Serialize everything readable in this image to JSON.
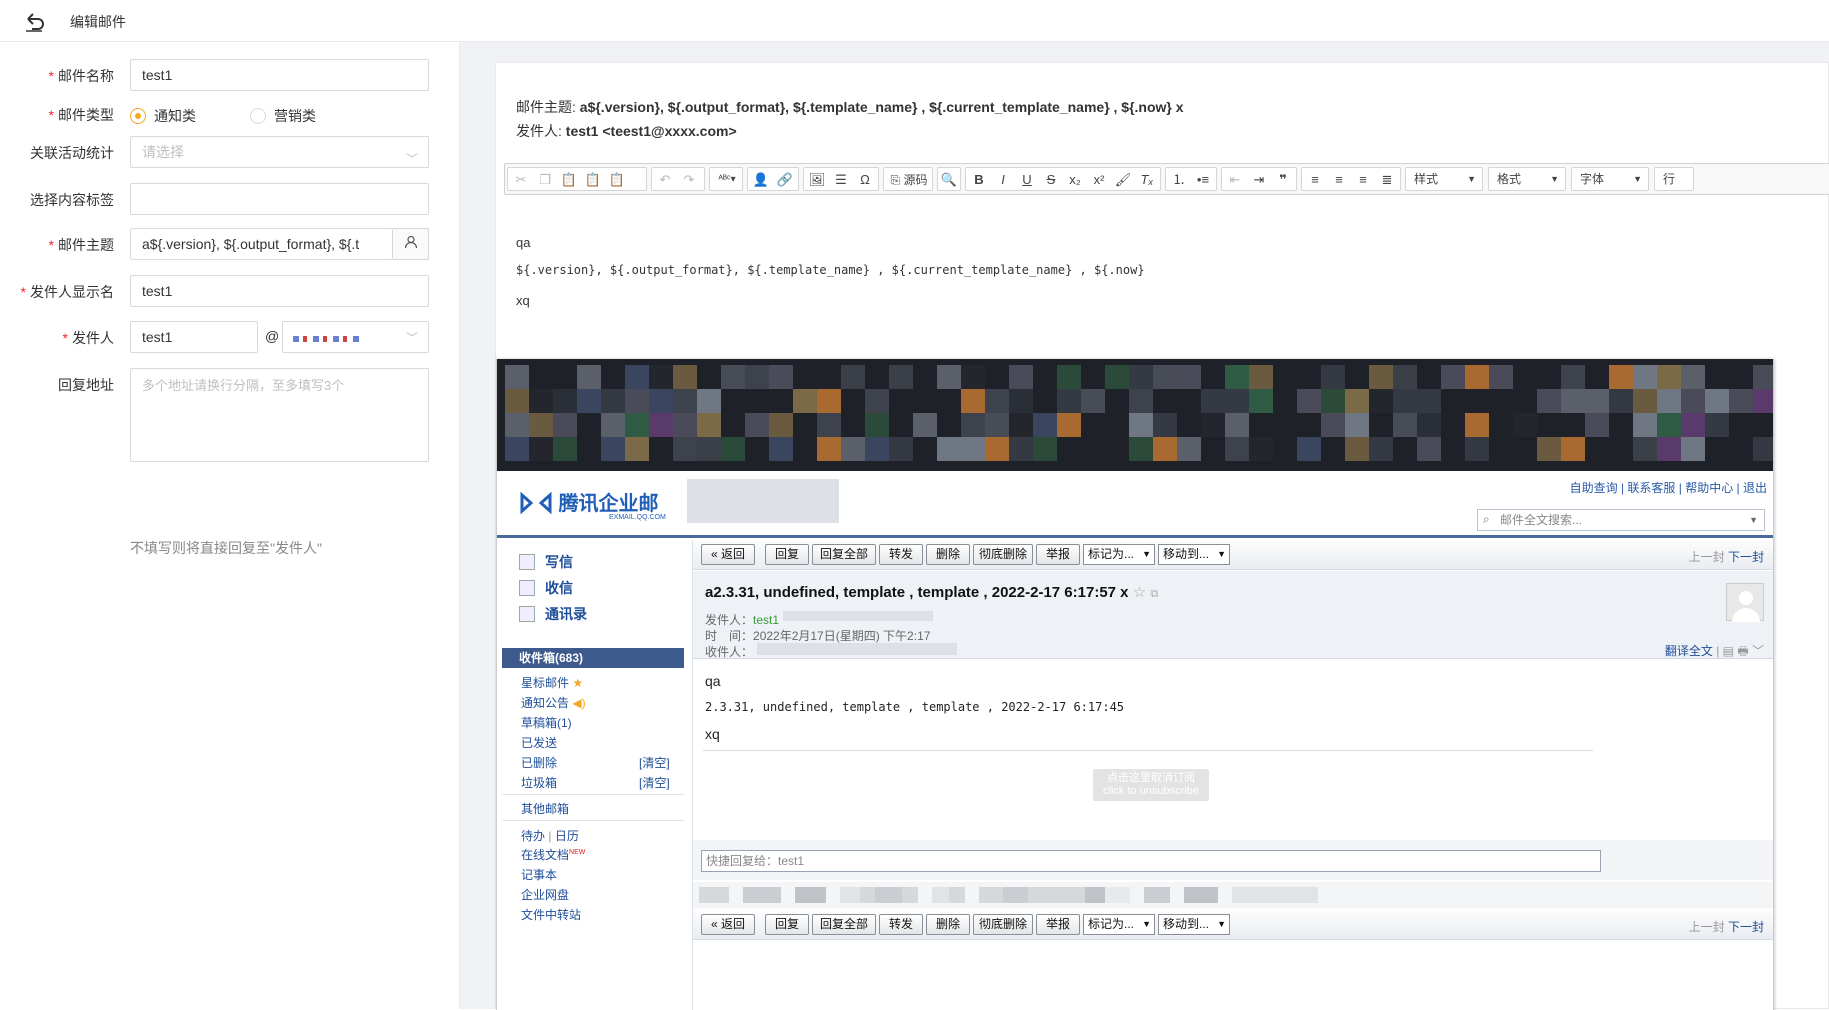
{
  "header": {
    "title": "编辑邮件"
  },
  "form": {
    "mail_name": {
      "label": "邮件名称",
      "value": "test1"
    },
    "mail_type": {
      "label": "邮件类型",
      "option1": "通知类",
      "option2": "营销类"
    },
    "activity": {
      "label": "关联活动统计",
      "placeholder": "请选择"
    },
    "tag": {
      "label": "选择内容标签",
      "value": ""
    },
    "subject": {
      "label": "邮件主题",
      "value": "a${.version}, ${.output_format}, ${.t"
    },
    "sender_name": {
      "label": "发件人显示名",
      "value": "test1"
    },
    "sender": {
      "label": "发件人",
      "value": "test1",
      "at": "@"
    },
    "reply": {
      "label": "回复地址",
      "placeholder": "多个地址请换行分隔，至多填写3个",
      "hint": "不填写则将直接回复至\"发件人\""
    }
  },
  "preview": {
    "subject_label": "邮件主题:",
    "subject_value": "a${.version}, ${.output_format}, ${.template_name} , ${.current_template_name} , ${.now} x",
    "from_label": "发件人:",
    "from_value": "test1 <teest1@xxxx.com>",
    "toolbar": {
      "source": "源码",
      "style": "样式",
      "format": "格式",
      "font": "字体",
      "more": "行"
    },
    "body_line1": "qa",
    "body_line2": "${.version},  ${.output_format},  ${.template_name} , ${.current_template_name} , ${.now}",
    "body_line3": "xq"
  },
  "qqmail": {
    "logo": "腾讯企业邮",
    "logo_sub": "EXMAIL.QQ.COM",
    "links": "自助查询 | 联系客服 | 帮助中心 | 退出",
    "search_placeholder": "邮件全文搜索...",
    "side": {
      "write": "写信",
      "receive": "收信",
      "contacts": "通讯录",
      "inbox": "收件箱(683)",
      "starred": "星标邮件",
      "notice": "通知公告",
      "drafts": "草稿箱(1)",
      "sent": "已发送",
      "deleted": "已删除",
      "spam": "垃圾箱",
      "clear": "[清空]",
      "other": "其他邮箱",
      "todo": "待办",
      "calendar": "日历",
      "docs": "在线文档",
      "new_badge": "NEW",
      "notes": "记事本",
      "disk": "企业网盘",
      "transfer": "文件中转站"
    },
    "bar": {
      "back": "« 返回",
      "reply": "回复",
      "reply_all": "回复全部",
      "forward": "转发",
      "delete": "删除",
      "delete_forever": "彻底删除",
      "report": "举报",
      "mark_as": "标记为...",
      "move_to": "移动到...",
      "prev": "上一封",
      "next": "下一封"
    },
    "mail": {
      "subject": "a2.3.31, undefined, template , template , 2022-2-17 6:17:57 x",
      "from_label": "发件人：",
      "from_value": "test1",
      "time_label": "时　间：",
      "time_value": "2022年2月17日(星期四) 下午2:17",
      "to_label": "收件人：",
      "translate": "翻译全文",
      "line1": "qa",
      "line2": "2.3.31,  undefined,  template , template , 2022-2-17 6:17:45",
      "line3": "xq",
      "unsub1": "点击这里取消订阅",
      "unsub2": "click to unsubscribe",
      "quick_reply": "快捷回复给：test1"
    }
  }
}
